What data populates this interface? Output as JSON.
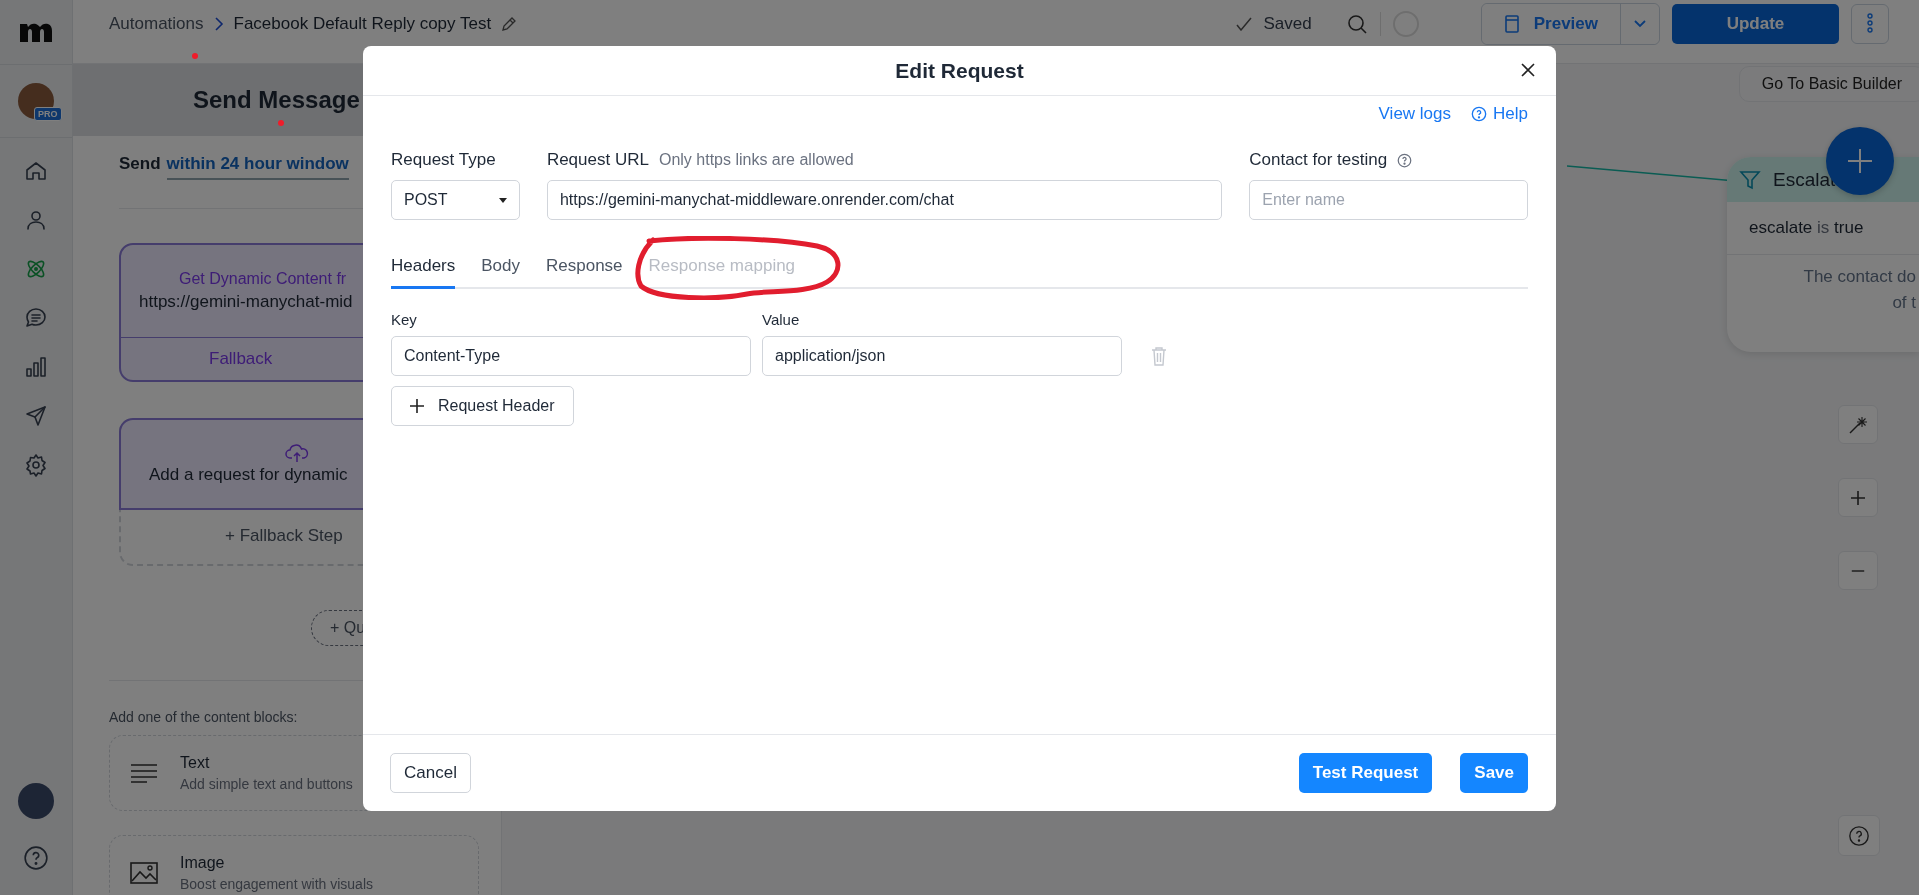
{
  "nav": {
    "badge": "PRO",
    "items": [
      {
        "kind": "home",
        "selected": false
      },
      {
        "kind": "user",
        "selected": false
      },
      {
        "kind": "atom",
        "selected": true
      },
      {
        "kind": "chat",
        "selected": false
      },
      {
        "kind": "chart",
        "selected": false
      },
      {
        "kind": "send",
        "selected": false
      },
      {
        "kind": "gear",
        "selected": false
      }
    ]
  },
  "topbar": {
    "breadcrumb": [
      "Automations",
      "Facebook Default Reply copy Test"
    ],
    "saved": "Saved",
    "preview": "Preview",
    "update": "Update"
  },
  "panel": {
    "title": "Send Message",
    "send_prefix": "Send",
    "send_link": "within 24 hour window",
    "request_card": {
      "title": "Get Dynamic Content fr",
      "url": "https://gemini-manychat-mid",
      "fallback": "Fallback"
    },
    "add_card": {
      "text": "Add a request for dynamic",
      "fallback_step": "+ Fallback Step"
    },
    "quick": "+ Qu",
    "blocks_label": "Add one of the content blocks:",
    "blocks": [
      {
        "kind": "text",
        "title": "Text",
        "description": "Add simple text and buttons"
      },
      {
        "kind": "image",
        "title": "Image",
        "description": "Boost engagement with visuals"
      }
    ]
  },
  "canvas": {
    "basic_builder": "Go To Basic Builder",
    "node": {
      "title": "Escalat",
      "field": "escalate",
      "operator": "is",
      "value": "true",
      "note": [
        "The contact do",
        "of t"
      ]
    }
  },
  "modal": {
    "title": "Edit Request",
    "view_logs": "View logs",
    "help": "Help",
    "request_type": {
      "label": "Request Type",
      "value": "POST"
    },
    "request_url": {
      "label": "Request URL",
      "hint": "Only https links are allowed",
      "value": "https://gemini-manychat-middleware.onrender.com/chat"
    },
    "contact": {
      "label": "Contact for testing",
      "placeholder": "Enter name"
    },
    "tabs": [
      {
        "label": "Headers",
        "selected": true,
        "disabled": false
      },
      {
        "label": "Body",
        "selected": false,
        "disabled": false
      },
      {
        "label": "Response",
        "selected": false,
        "disabled": false
      },
      {
        "label": "Response mapping",
        "selected": false,
        "disabled": true
      }
    ],
    "key_label": "Key",
    "value_label": "Value",
    "headers": [
      {
        "key": "Content-Type",
        "value": "application/json"
      }
    ],
    "add_header": "Request Header",
    "cancel": "Cancel",
    "test": "Test Request",
    "save": "Save"
  }
}
